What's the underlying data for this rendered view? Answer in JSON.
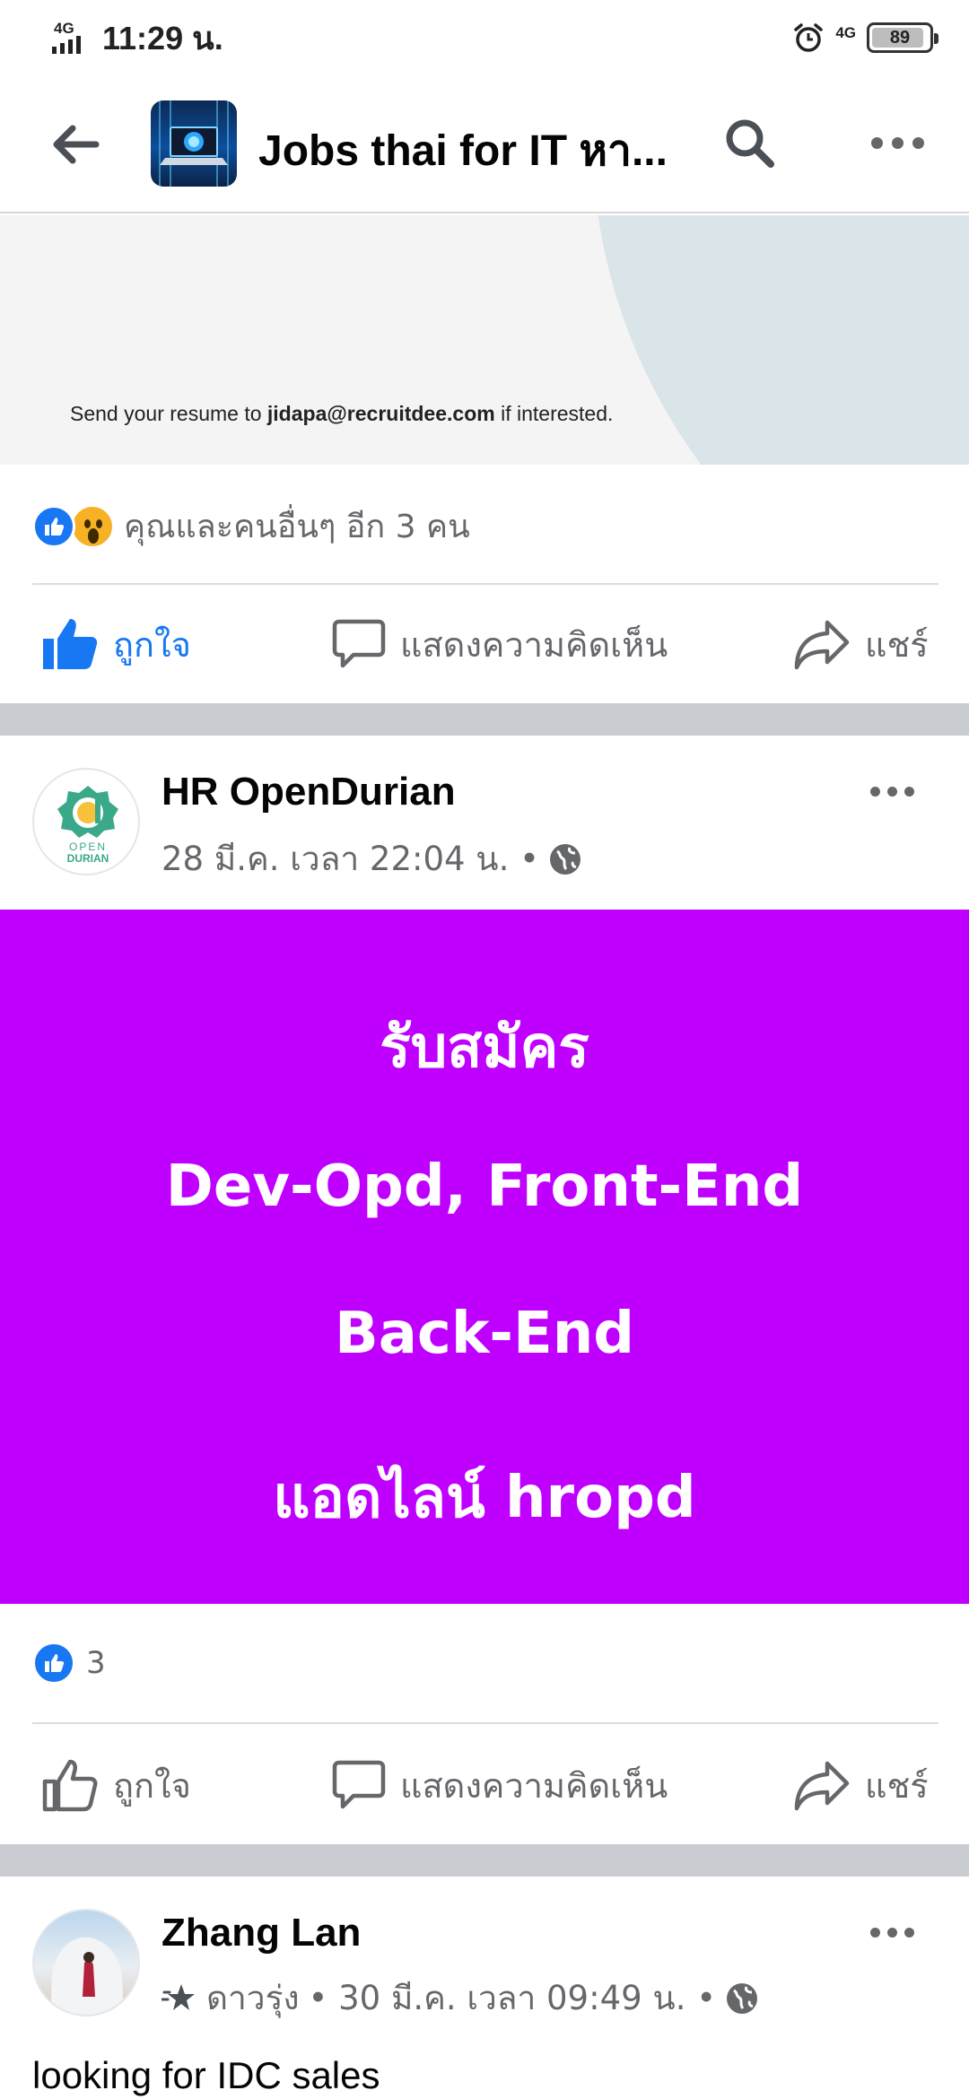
{
  "status_bar": {
    "network": "4G",
    "time": "11:29 น.",
    "network_right": "4G",
    "battery": "89"
  },
  "app_bar": {
    "title": "Jobs thai for IT หา...",
    "back_icon": "arrow-left-icon",
    "search_icon": "search-icon",
    "more_icon": "more-horizontal-icon"
  },
  "post1": {
    "image_text_prefix": "Send your resume to ",
    "image_text_email": "jidapa@recruitdee.com",
    "image_text_suffix": " if interested.",
    "reactions_text": "คุณและคนอื่นๆ อีก 3 คน",
    "actions": {
      "like": "ถูกใจ",
      "comment": "แสดงความคิดเห็น",
      "share": "แชร์"
    }
  },
  "post2": {
    "author": "HR OpenDurian",
    "avatar_text_top": "OPEN",
    "avatar_text_bottom": "DURIAN",
    "timestamp": "28 มี.ค. เวลา 22:04 น. •",
    "banner_lines": [
      "รับสมัคร",
      "Dev-Opd, Front-End",
      "Back-End",
      "แอดไลน์ hropd"
    ],
    "banner_color": "#c000ff",
    "reaction_count": "3",
    "actions": {
      "like": "ถูกใจ",
      "comment": "แสดงความคิดเห็น",
      "share": "แชร์"
    }
  },
  "post3": {
    "author": "Zhang Lan",
    "badge": "ดาวรุ่ง",
    "timestamp": "• 30 มี.ค. เวลา 09:49 น. •",
    "body": "looking for IDC sales"
  },
  "colors": {
    "accent": "#1877f2",
    "secondary_text": "#65676b",
    "separator": "#c9ccd1"
  }
}
